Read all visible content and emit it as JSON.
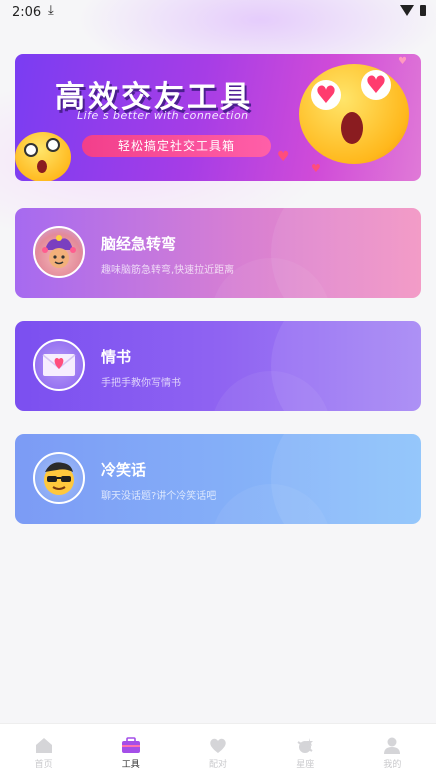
{
  "status_bar": {
    "time": "2:06",
    "download_icon": "download-arrow-icon",
    "wifi_icon": "wifi-icon",
    "battery_icon": "battery-icon"
  },
  "banner": {
    "title": "高效交友工具",
    "tagline": "Life s better with connection",
    "pill_text": "轻松搞定社交工具箱"
  },
  "tools": [
    {
      "name": "脑经急转弯",
      "desc": "趣味脑筋急转弯,快速拉近距离",
      "icon": "jester-hat-emoji-icon"
    },
    {
      "name": "情书",
      "desc": "手把手教你写情书",
      "icon": "love-letter-icon"
    },
    {
      "name": "冷笑话",
      "desc": "聊天没话题?讲个冷笑话吧",
      "icon": "cool-sunglasses-emoji-icon"
    }
  ],
  "tabbar": {
    "items": [
      {
        "label": "首页",
        "icon": "home-icon",
        "active": false
      },
      {
        "label": "工具",
        "icon": "toolbox-icon",
        "active": true
      },
      {
        "label": "配对",
        "icon": "heart-match-icon",
        "active": false
      },
      {
        "label": "星座",
        "icon": "constellation-icon",
        "active": false
      },
      {
        "label": "我的",
        "icon": "profile-icon",
        "active": false
      }
    ]
  },
  "colors": {
    "banner_start": "#7a3df2",
    "banner_end": "#e07ad7",
    "card1_start": "#a66af0",
    "card1_end": "#f294c3",
    "card2_start": "#7b4ff0",
    "card2_end": "#a688f5",
    "card3_start": "#7c9bf5",
    "card3_end": "#8cc3fb",
    "tab_active": "#333333",
    "tab_inactive": "#c9c9cc"
  }
}
